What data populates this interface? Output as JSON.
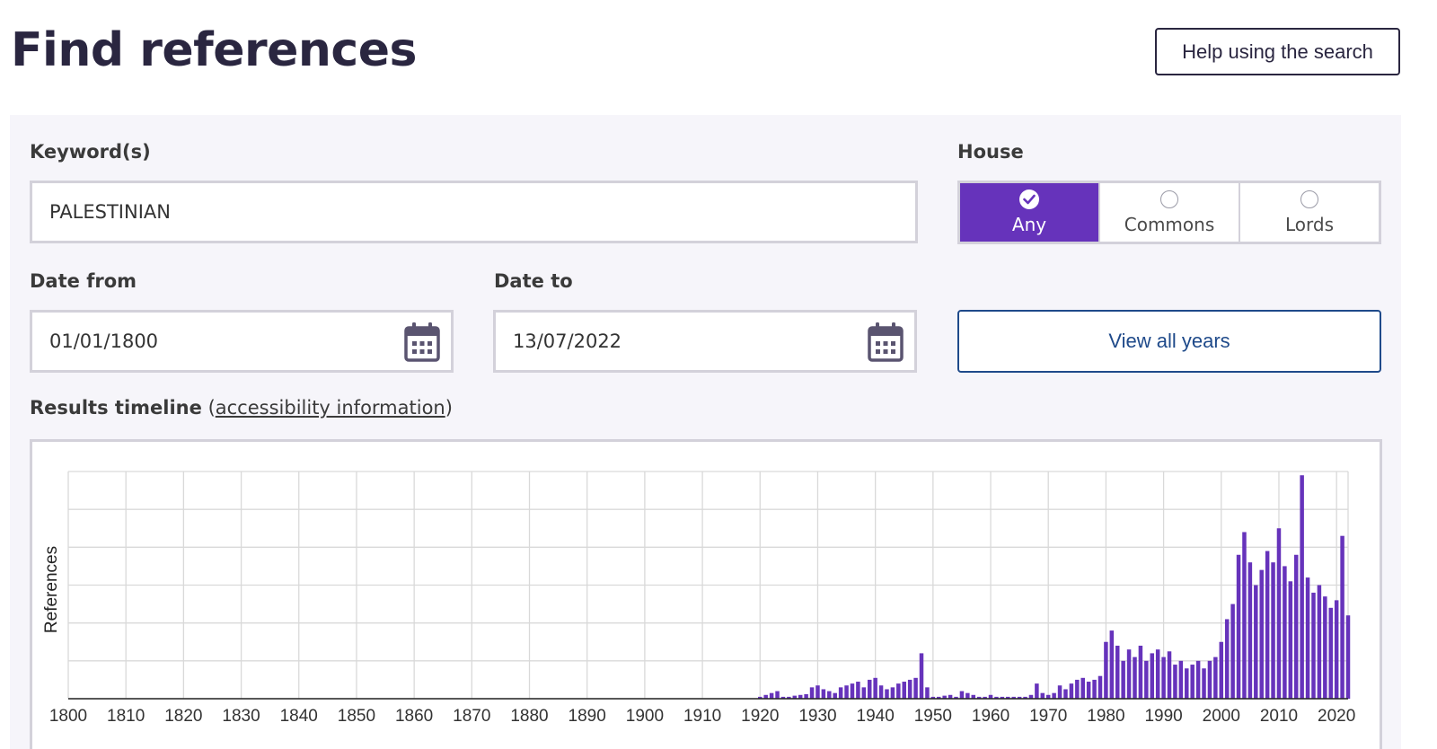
{
  "header": {
    "title": "Find references",
    "help_label": "Help using the search"
  },
  "form": {
    "keywords_label": "Keyword(s)",
    "keywords_value": "PALESTINIAN",
    "house_label": "House",
    "house_options": [
      {
        "label": "Any",
        "selected": true
      },
      {
        "label": "Commons",
        "selected": false
      },
      {
        "label": "Lords",
        "selected": false
      }
    ],
    "date_from_label": "Date from",
    "date_from_value": "01/01/1800",
    "date_to_label": "Date to",
    "date_to_value": "13/07/2022",
    "view_all_label": "View all years"
  },
  "timeline": {
    "title": "Results timeline",
    "link_label": "accessibility information",
    "open_paren": "(",
    "close_paren": ")"
  },
  "icons": {
    "calendar": "calendar-icon",
    "check": "check-icon",
    "radio": "radio-icon"
  },
  "colors": {
    "accent": "#6633bb",
    "link_button": "#1f4a8a",
    "panel_bg": "#f6f5fa",
    "border": "#d3d1da"
  },
  "chart_data": {
    "type": "bar",
    "ylabel": "References",
    "xlabel": "",
    "xlim": [
      1800,
      2022
    ],
    "ylim": [
      0,
      6
    ],
    "x_ticks": [
      1800,
      1810,
      1820,
      1830,
      1840,
      1850,
      1860,
      1870,
      1880,
      1890,
      1900,
      1910,
      1920,
      1930,
      1940,
      1950,
      1960,
      1970,
      1980,
      1990,
      2000,
      2010,
      2020
    ],
    "grid": true,
    "series": [
      {
        "x": [
          1920,
          1921,
          1922,
          1923,
          1924,
          1925,
          1926,
          1927,
          1928,
          1929,
          1930,
          1931,
          1932,
          1933,
          1934,
          1935,
          1936,
          1937,
          1938,
          1939,
          1940,
          1941,
          1942,
          1943,
          1944,
          1945,
          1946,
          1947,
          1948,
          1949,
          1950,
          1951,
          1952,
          1953,
          1954,
          1955,
          1956,
          1957,
          1958,
          1959,
          1960,
          1961,
          1962,
          1963,
          1964,
          1965,
          1966,
          1967,
          1968,
          1969,
          1970,
          1971,
          1972,
          1973,
          1974,
          1975,
          1976,
          1977,
          1978,
          1979,
          1980,
          1981,
          1982,
          1983,
          1984,
          1985,
          1986,
          1987,
          1988,
          1989,
          1990,
          1991,
          1992,
          1993,
          1994,
          1995,
          1996,
          1997,
          1998,
          1999,
          2000,
          2001,
          2002,
          2003,
          2004,
          2005,
          2006,
          2007,
          2008,
          2009,
          2010,
          2011,
          2012,
          2013,
          2014,
          2015,
          2016,
          2017,
          2018,
          2019,
          2020,
          2021,
          2022
        ],
        "values": [
          0.05,
          0.1,
          0.15,
          0.2,
          0.05,
          0.05,
          0.08,
          0.1,
          0.12,
          0.3,
          0.35,
          0.25,
          0.2,
          0.15,
          0.3,
          0.35,
          0.4,
          0.45,
          0.3,
          0.5,
          0.55,
          0.35,
          0.25,
          0.3,
          0.4,
          0.45,
          0.5,
          0.55,
          1.2,
          0.3,
          0.05,
          0.05,
          0.08,
          0.1,
          0.05,
          0.2,
          0.15,
          0.1,
          0.05,
          0.05,
          0.1,
          0.05,
          0.05,
          0.05,
          0.05,
          0.05,
          0.05,
          0.1,
          0.4,
          0.15,
          0.1,
          0.15,
          0.35,
          0.25,
          0.4,
          0.5,
          0.55,
          0.45,
          0.5,
          0.6,
          1.5,
          1.8,
          1.4,
          1.0,
          1.3,
          1.1,
          1.4,
          1.0,
          1.2,
          1.3,
          1.1,
          1.25,
          0.9,
          1.0,
          0.8,
          0.9,
          1.0,
          0.8,
          1.0,
          1.1,
          1.5,
          2.1,
          2.5,
          3.8,
          4.4,
          3.6,
          3.0,
          3.4,
          3.9,
          3.6,
          4.5,
          3.5,
          3.1,
          3.8,
          5.9,
          3.2,
          2.8,
          3.0,
          2.7,
          2.4,
          2.6,
          4.3,
          2.2
        ]
      }
    ]
  }
}
